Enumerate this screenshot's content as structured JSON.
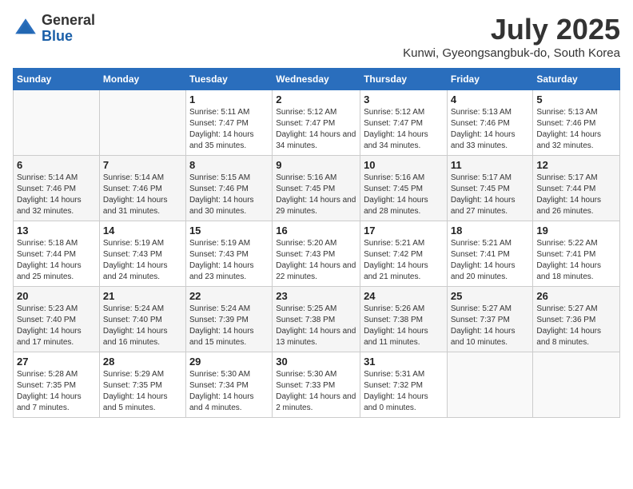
{
  "logo": {
    "general": "General",
    "blue": "Blue"
  },
  "title": "July 2025",
  "subtitle": "Kunwi, Gyeongsangbuk-do, South Korea",
  "weekdays": [
    "Sunday",
    "Monday",
    "Tuesday",
    "Wednesday",
    "Thursday",
    "Friday",
    "Saturday"
  ],
  "weeks": [
    [
      {
        "day": "",
        "info": ""
      },
      {
        "day": "",
        "info": ""
      },
      {
        "day": "1",
        "info": "Sunrise: 5:11 AM\nSunset: 7:47 PM\nDaylight: 14 hours and 35 minutes."
      },
      {
        "day": "2",
        "info": "Sunrise: 5:12 AM\nSunset: 7:47 PM\nDaylight: 14 hours and 34 minutes."
      },
      {
        "day": "3",
        "info": "Sunrise: 5:12 AM\nSunset: 7:47 PM\nDaylight: 14 hours and 34 minutes."
      },
      {
        "day": "4",
        "info": "Sunrise: 5:13 AM\nSunset: 7:46 PM\nDaylight: 14 hours and 33 minutes."
      },
      {
        "day": "5",
        "info": "Sunrise: 5:13 AM\nSunset: 7:46 PM\nDaylight: 14 hours and 32 minutes."
      }
    ],
    [
      {
        "day": "6",
        "info": "Sunrise: 5:14 AM\nSunset: 7:46 PM\nDaylight: 14 hours and 32 minutes."
      },
      {
        "day": "7",
        "info": "Sunrise: 5:14 AM\nSunset: 7:46 PM\nDaylight: 14 hours and 31 minutes."
      },
      {
        "day": "8",
        "info": "Sunrise: 5:15 AM\nSunset: 7:46 PM\nDaylight: 14 hours and 30 minutes."
      },
      {
        "day": "9",
        "info": "Sunrise: 5:16 AM\nSunset: 7:45 PM\nDaylight: 14 hours and 29 minutes."
      },
      {
        "day": "10",
        "info": "Sunrise: 5:16 AM\nSunset: 7:45 PM\nDaylight: 14 hours and 28 minutes."
      },
      {
        "day": "11",
        "info": "Sunrise: 5:17 AM\nSunset: 7:45 PM\nDaylight: 14 hours and 27 minutes."
      },
      {
        "day": "12",
        "info": "Sunrise: 5:17 AM\nSunset: 7:44 PM\nDaylight: 14 hours and 26 minutes."
      }
    ],
    [
      {
        "day": "13",
        "info": "Sunrise: 5:18 AM\nSunset: 7:44 PM\nDaylight: 14 hours and 25 minutes."
      },
      {
        "day": "14",
        "info": "Sunrise: 5:19 AM\nSunset: 7:43 PM\nDaylight: 14 hours and 24 minutes."
      },
      {
        "day": "15",
        "info": "Sunrise: 5:19 AM\nSunset: 7:43 PM\nDaylight: 14 hours and 23 minutes."
      },
      {
        "day": "16",
        "info": "Sunrise: 5:20 AM\nSunset: 7:43 PM\nDaylight: 14 hours and 22 minutes."
      },
      {
        "day": "17",
        "info": "Sunrise: 5:21 AM\nSunset: 7:42 PM\nDaylight: 14 hours and 21 minutes."
      },
      {
        "day": "18",
        "info": "Sunrise: 5:21 AM\nSunset: 7:41 PM\nDaylight: 14 hours and 20 minutes."
      },
      {
        "day": "19",
        "info": "Sunrise: 5:22 AM\nSunset: 7:41 PM\nDaylight: 14 hours and 18 minutes."
      }
    ],
    [
      {
        "day": "20",
        "info": "Sunrise: 5:23 AM\nSunset: 7:40 PM\nDaylight: 14 hours and 17 minutes."
      },
      {
        "day": "21",
        "info": "Sunrise: 5:24 AM\nSunset: 7:40 PM\nDaylight: 14 hours and 16 minutes."
      },
      {
        "day": "22",
        "info": "Sunrise: 5:24 AM\nSunset: 7:39 PM\nDaylight: 14 hours and 15 minutes."
      },
      {
        "day": "23",
        "info": "Sunrise: 5:25 AM\nSunset: 7:38 PM\nDaylight: 14 hours and 13 minutes."
      },
      {
        "day": "24",
        "info": "Sunrise: 5:26 AM\nSunset: 7:38 PM\nDaylight: 14 hours and 11 minutes."
      },
      {
        "day": "25",
        "info": "Sunrise: 5:27 AM\nSunset: 7:37 PM\nDaylight: 14 hours and 10 minutes."
      },
      {
        "day": "26",
        "info": "Sunrise: 5:27 AM\nSunset: 7:36 PM\nDaylight: 14 hours and 8 minutes."
      }
    ],
    [
      {
        "day": "27",
        "info": "Sunrise: 5:28 AM\nSunset: 7:35 PM\nDaylight: 14 hours and 7 minutes."
      },
      {
        "day": "28",
        "info": "Sunrise: 5:29 AM\nSunset: 7:35 PM\nDaylight: 14 hours and 5 minutes."
      },
      {
        "day": "29",
        "info": "Sunrise: 5:30 AM\nSunset: 7:34 PM\nDaylight: 14 hours and 4 minutes."
      },
      {
        "day": "30",
        "info": "Sunrise: 5:30 AM\nSunset: 7:33 PM\nDaylight: 14 hours and 2 minutes."
      },
      {
        "day": "31",
        "info": "Sunrise: 5:31 AM\nSunset: 7:32 PM\nDaylight: 14 hours and 0 minutes."
      },
      {
        "day": "",
        "info": ""
      },
      {
        "day": "",
        "info": ""
      }
    ]
  ]
}
